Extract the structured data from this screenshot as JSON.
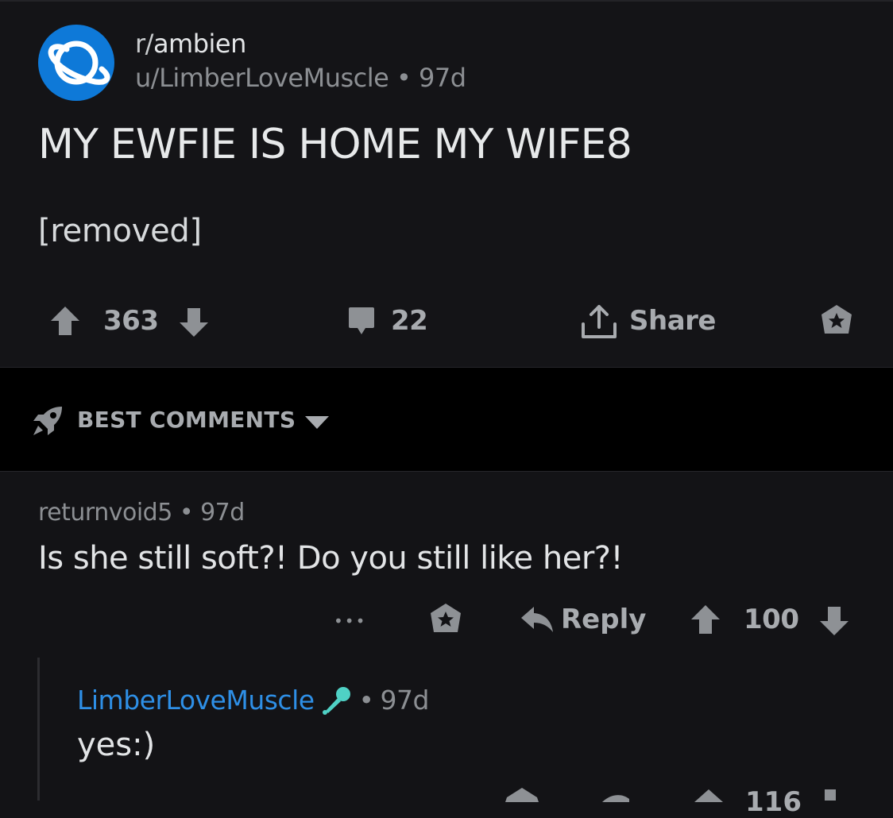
{
  "post": {
    "subreddit_prefix": "r/",
    "subreddit": "ambien",
    "author": "u/LimberLoveMuscle",
    "age": "97d",
    "title": "MY EWFIE IS HOME MY WIFE8",
    "body": "[removed]",
    "score": "363",
    "comments": "22",
    "share_label": "Share",
    "icons": [
      "planet-icon",
      "upvote-icon",
      "downvote-icon",
      "comment-icon",
      "share-icon",
      "award-icon"
    ]
  },
  "sort": {
    "label": "BEST COMMENTS",
    "icons": [
      "rocket-icon",
      "caret-down-icon"
    ]
  },
  "comment": {
    "author": "returnvoid5",
    "age": "97d",
    "text": "Is she still soft?! Do you still like her?!",
    "more_label": "•••",
    "reply_label": "Reply",
    "score": "100"
  },
  "reply": {
    "author": "LimberLoveMuscle",
    "age": "97d",
    "text": "yes:)",
    "flair_icon": "microphone-icon",
    "score_partial": "116"
  },
  "colors": {
    "background": "#141417",
    "section_divider": "#000000",
    "subreddit_avatar": "#0e79d8",
    "op_username": "#2e8fe6",
    "flair_mic": "#4fd1c5",
    "muted_text": "#8c8f93",
    "action_gray": "#a8abaf"
  }
}
